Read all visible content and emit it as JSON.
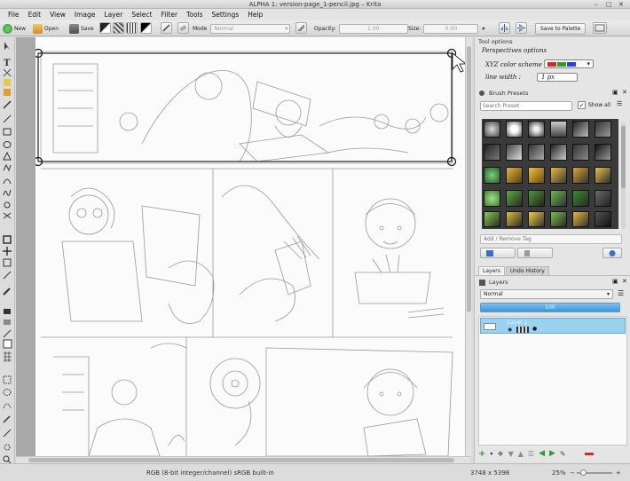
{
  "window": {
    "title": "ALPHA 1: version-page_1-pencil.jpg – Krita",
    "controls": [
      "–",
      "□",
      "✕"
    ]
  },
  "menu": [
    "File",
    "Edit",
    "View",
    "Image",
    "Layer",
    "Select",
    "Filter",
    "Tools",
    "Settings",
    "Help"
  ],
  "toolbar": {
    "new_label": "New",
    "open_label": "Open",
    "save_label": "Save",
    "mode_label": "Mode",
    "mode_value": "Normal",
    "opacity_label": "Opacity:",
    "opacity_value": "1.00",
    "size_label": "Size:",
    "size_value": "0.00",
    "save_palette_label": "Save to Palette"
  },
  "tool_options": {
    "title": "Tool options",
    "perspective_label": "Perspectives options",
    "color_scheme_label": "XYZ color scheme",
    "line_width_label": "line width :",
    "line_width_value": "1 px"
  },
  "brush_presets": {
    "title": "Brush Presets",
    "search_placeholder": "Search Preset",
    "show_all_label": "Show all",
    "tag_placeholder": "Add / Remove Tag"
  },
  "layer_tabs": [
    "Layers",
    "Undo History"
  ],
  "layers": {
    "title": "Layers",
    "blend_mode": "Normal",
    "opacity_value": "100",
    "layer_name": "Layer 1"
  },
  "status": {
    "color_info": "RGB (8-bit integer/channel)  sRGB built-in",
    "dimensions": "3748 x 5398",
    "zoom": "25%"
  },
  "colors": {
    "selection_blue": "#9ad2f0",
    "accent_green": "#2e9d2e",
    "accent_red": "#d42a2a"
  }
}
